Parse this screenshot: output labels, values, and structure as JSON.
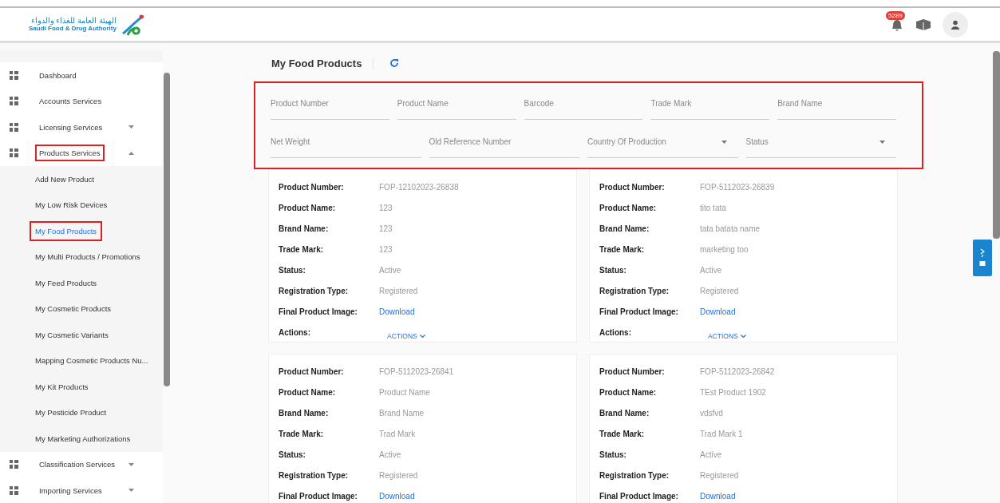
{
  "header": {
    "logo_arabic": "الهيئة العامة للغذاء والدواء",
    "logo_english": "Saudi Food & Drug Authority",
    "notification_count": "5289"
  },
  "sidebar": {
    "items": [
      {
        "label": "Dashboard",
        "kind": "link",
        "highlighted": false
      },
      {
        "label": "Accounts Services",
        "kind": "link",
        "highlighted": false
      },
      {
        "label": "Licensing Services",
        "kind": "group",
        "expanded": false,
        "highlighted": false
      },
      {
        "label": "Products Services",
        "kind": "group",
        "expanded": true,
        "highlighted": true,
        "children": [
          {
            "label": "Add New Product",
            "selected": false,
            "highlighted": false
          },
          {
            "label": "My Low Risk Devices",
            "selected": false,
            "highlighted": false
          },
          {
            "label": "My Food Products",
            "selected": true,
            "highlighted": true
          },
          {
            "label": "My Multi Products / Promotions",
            "selected": false,
            "highlighted": false
          },
          {
            "label": "My Feed Products",
            "selected": false,
            "highlighted": false
          },
          {
            "label": "My Cosmetic Products",
            "selected": false,
            "highlighted": false
          },
          {
            "label": "My Cosmetic Variants",
            "selected": false,
            "highlighted": false
          },
          {
            "label": "Mapping Cosmetic Products Nu...",
            "selected": false,
            "highlighted": false
          },
          {
            "label": "My Kit Products",
            "selected": false,
            "highlighted": false
          },
          {
            "label": "My Pesticide Product",
            "selected": false,
            "highlighted": false
          },
          {
            "label": "My Marketing Authorizations",
            "selected": false,
            "highlighted": false
          }
        ]
      },
      {
        "label": "Classification Services",
        "kind": "group",
        "expanded": false,
        "highlighted": false
      },
      {
        "label": "Importing Services",
        "kind": "group",
        "expanded": false,
        "highlighted": false
      }
    ]
  },
  "page": {
    "title": "My Food Products"
  },
  "filters": {
    "highlighted": true,
    "rows": [
      [
        {
          "placeholder": "Product Number",
          "kind": "text"
        },
        {
          "placeholder": "Product Name",
          "kind": "text"
        },
        {
          "placeholder": "Barcode",
          "kind": "text"
        },
        {
          "placeholder": "Trade Mark",
          "kind": "text"
        },
        {
          "placeholder": "Brand Name",
          "kind": "text"
        }
      ],
      [
        {
          "placeholder": "Net Weight",
          "kind": "text"
        },
        {
          "placeholder": "Old Reference Number",
          "kind": "text"
        },
        {
          "placeholder": "Country Of Production",
          "kind": "select"
        },
        {
          "placeholder": "Status",
          "kind": "select"
        }
      ]
    ]
  },
  "cards": [
    {
      "fields": [
        {
          "label": "Product Number:",
          "value": "FOP-12102023-26838",
          "kind": "text"
        },
        {
          "label": "Product Name:",
          "value": "123",
          "kind": "text"
        },
        {
          "label": "Brand Name:",
          "value": "123",
          "kind": "text"
        },
        {
          "label": "Trade Mark:",
          "value": "123",
          "kind": "text"
        },
        {
          "label": "Status:",
          "value": "Active",
          "kind": "text"
        },
        {
          "label": "Registration Type:",
          "value": "Registered",
          "kind": "text"
        },
        {
          "label": "Final Product Image:",
          "value": "Download",
          "kind": "link"
        },
        {
          "label": "Actions:",
          "value": "ACTIONS",
          "kind": "menu"
        }
      ]
    },
    {
      "fields": [
        {
          "label": "Product Number:",
          "value": "FOP-5112023-26839",
          "kind": "text"
        },
        {
          "label": "Product Name:",
          "value": "tito tata",
          "kind": "text"
        },
        {
          "label": "Brand Name:",
          "value": "tata batata name",
          "kind": "text"
        },
        {
          "label": "Trade Mark:",
          "value": "marketing too",
          "kind": "text"
        },
        {
          "label": "Status:",
          "value": "Active",
          "kind": "text"
        },
        {
          "label": "Registration Type:",
          "value": "Registered",
          "kind": "text"
        },
        {
          "label": "Final Product Image:",
          "value": "Download",
          "kind": "link"
        },
        {
          "label": "Actions:",
          "value": "ACTIONS",
          "kind": "menu"
        }
      ]
    },
    {
      "fields": [
        {
          "label": "Product Number:",
          "value": "FOP-5112023-26841",
          "kind": "text"
        },
        {
          "label": "Product Name:",
          "value": "Product Name",
          "kind": "text"
        },
        {
          "label": "Brand Name:",
          "value": "Brand Name",
          "kind": "text"
        },
        {
          "label": "Trade Mark:",
          "value": "Trad Mark",
          "kind": "text"
        },
        {
          "label": "Status:",
          "value": "Active",
          "kind": "text"
        },
        {
          "label": "Registration Type:",
          "value": "Registered",
          "kind": "text"
        },
        {
          "label": "Final Product Image:",
          "value": "Download",
          "kind": "link"
        }
      ]
    },
    {
      "fields": [
        {
          "label": "Product Number:",
          "value": "FOP-5112023-26842",
          "kind": "text"
        },
        {
          "label": "Product Name:",
          "value": "TEst Product 1902",
          "kind": "text"
        },
        {
          "label": "Brand Name:",
          "value": "vdsfvd",
          "kind": "text"
        },
        {
          "label": "Trade Mark:",
          "value": "Trad Mark 1",
          "kind": "text"
        },
        {
          "label": "Status:",
          "value": "Active",
          "kind": "text"
        },
        {
          "label": "Registration Type:",
          "value": "Registered",
          "kind": "text"
        },
        {
          "label": "Final Product Image:",
          "value": "Download",
          "kind": "link"
        }
      ]
    }
  ]
}
